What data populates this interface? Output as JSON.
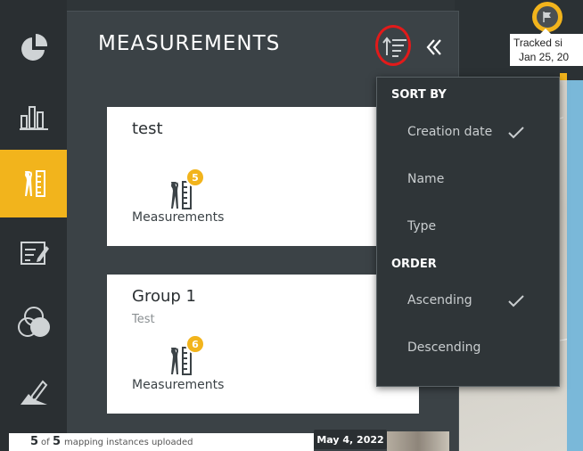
{
  "panel": {
    "title": "MEASUREMENTS"
  },
  "cards": [
    {
      "title": "test",
      "subtitle": "",
      "badge": "5",
      "label": "Measurements"
    },
    {
      "title": "Group 1",
      "subtitle": "Test",
      "badge": "6",
      "label": "Measurements"
    }
  ],
  "sort_menu": {
    "sort_heading": "SORT BY",
    "sort_options": [
      {
        "label": "Creation date",
        "checked": true
      },
      {
        "label": "Name",
        "checked": false
      },
      {
        "label": "Type",
        "checked": false
      }
    ],
    "order_heading": "ORDER",
    "order_options": [
      {
        "label": "Ascending",
        "checked": true
      },
      {
        "label": "Descending",
        "checked": false
      }
    ]
  },
  "tooltip": {
    "line1": "Tracked si",
    "line2": "Jan 25, 20"
  },
  "bottom": {
    "uploaded_count": "5",
    "of_text": "of",
    "total_count": "5",
    "suffix": "mapping instances uploaded",
    "date": "May 4, 2022"
  },
  "nav": {
    "items": [
      {
        "icon": "pie-chart-icon"
      },
      {
        "icon": "bar-chart-icon"
      },
      {
        "icon": "measurement-tools-icon",
        "active": true
      },
      {
        "icon": "edit-note-icon"
      },
      {
        "icon": "layers-circles-icon"
      },
      {
        "icon": "draw-area-icon"
      }
    ]
  },
  "colors": {
    "accent": "#f2b41c",
    "panel": "#3b4246",
    "nav": "#2a2f32",
    "highlight_ring": "#e21a1a"
  }
}
